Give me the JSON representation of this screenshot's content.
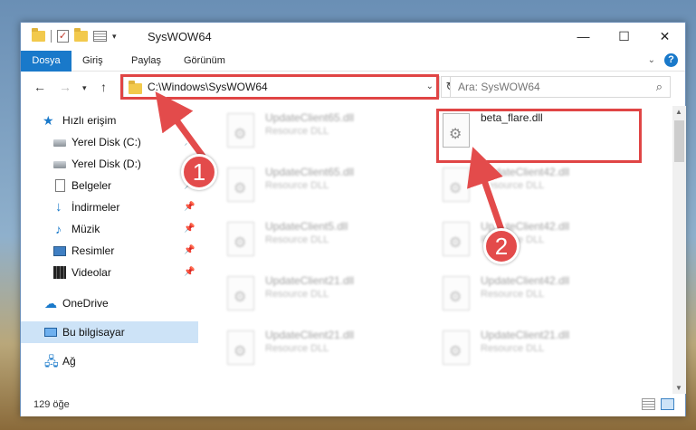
{
  "window": {
    "title": "SysWOW64",
    "controls": {
      "minimize": "—",
      "maximize": "☐",
      "close": "✕"
    }
  },
  "ribbon": {
    "tabs": [
      "Dosya",
      "Giriş",
      "Paylaş",
      "Görünüm"
    ],
    "help": "?"
  },
  "address": {
    "path": "C:\\Windows\\SysWOW64",
    "search_placeholder": "Ara: SysWOW64"
  },
  "sidebar": {
    "quick_access": "Hızlı erişim",
    "items": [
      {
        "label": "Yerel Disk (C:)",
        "icon": "drive-icon",
        "pinned": true
      },
      {
        "label": "Yerel Disk (D:)",
        "icon": "drive-icon",
        "pinned": true
      },
      {
        "label": "Belgeler",
        "icon": "documents-icon",
        "pinned": true
      },
      {
        "label": "İndirmeler",
        "icon": "downloads-icon",
        "pinned": true
      },
      {
        "label": "Müzik",
        "icon": "music-icon",
        "pinned": true
      },
      {
        "label": "Resimler",
        "icon": "pictures-icon",
        "pinned": true
      },
      {
        "label": "Videolar",
        "icon": "videos-icon",
        "pinned": true
      }
    ],
    "onedrive": "OneDrive",
    "this_pc": "Bu bilgisayar",
    "network": "Ağ"
  },
  "files": {
    "left_column": [
      {
        "name": "UpdateClient65.dll",
        "type": "Resource DLL"
      },
      {
        "name": "UpdateClient65.dll",
        "type": "Resource DLL"
      },
      {
        "name": "UpdateClient5.dll",
        "type": "Resource DLL"
      },
      {
        "name": "UpdateClient21.dll",
        "type": "Resource DLL"
      },
      {
        "name": "UpdateClient21.dll",
        "type": "Resource DLL"
      }
    ],
    "right_column": [
      {
        "name": "beta_flare.dll",
        "type": ""
      },
      {
        "name": "UpdateClient42.dll",
        "type": "Resource DLL"
      },
      {
        "name": "UpdateClient42.dll",
        "type": "Resource DLL"
      },
      {
        "name": "UpdateClient42.dll",
        "type": "Resource DLL"
      },
      {
        "name": "UpdateClient21.dll",
        "type": "Resource DLL"
      }
    ]
  },
  "status": {
    "count": "129 öğe"
  },
  "annotations": {
    "badge1": "1",
    "badge2": "2",
    "color": "#e34b4b"
  }
}
